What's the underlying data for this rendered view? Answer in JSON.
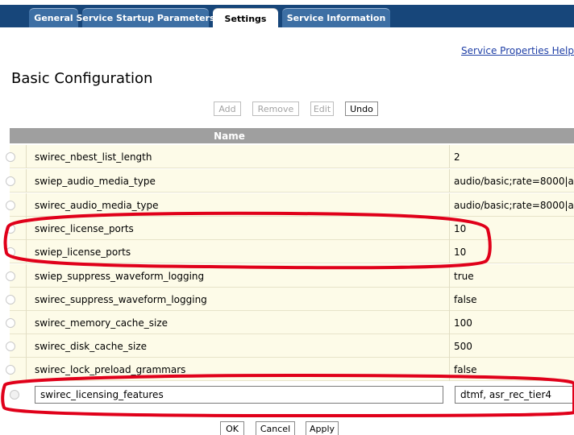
{
  "tabs": [
    {
      "label": "General"
    },
    {
      "label": "Service Startup Parameters"
    },
    {
      "label": "Settings"
    },
    {
      "label": "Service Information"
    }
  ],
  "help_link": "Service Properties Help",
  "page_title": "Basic Configuration",
  "toolbar": {
    "add": "Add",
    "remove": "Remove",
    "edit": "Edit",
    "undo": "Undo"
  },
  "table": {
    "header_name": "Name",
    "rows": [
      {
        "name": "swirec_nbest_list_length",
        "value": "2"
      },
      {
        "name": "swiep_audio_media_type",
        "value": "audio/basic;rate=8000|a"
      },
      {
        "name": "swirec_audio_media_type",
        "value": "audio/basic;rate=8000|a"
      },
      {
        "name": "swirec_license_ports",
        "value": "10"
      },
      {
        "name": "swiep_license_ports",
        "value": "10"
      },
      {
        "name": "swiep_suppress_waveform_logging",
        "value": "true"
      },
      {
        "name": "swirec_suppress_waveform_logging",
        "value": "false"
      },
      {
        "name": "swirec_memory_cache_size",
        "value": "100"
      },
      {
        "name": "swirec_disk_cache_size",
        "value": "500"
      },
      {
        "name": "swirec_lock_preload_grammars",
        "value": "false"
      }
    ],
    "edit_row": {
      "name_value": "swirec_licensing_features",
      "value_value": "dtmf, asr_rec_tier4"
    }
  },
  "footer": {
    "ok": "OK",
    "cancel": "Cancel",
    "apply": "Apply"
  },
  "colors": {
    "tab_bar": "#17467a",
    "tab": "#3d6fa4",
    "row_bg": "#fdfbe8",
    "header_bg": "#9f9f9f",
    "annotation": "#e0001a",
    "link": "#1f3fa6"
  }
}
